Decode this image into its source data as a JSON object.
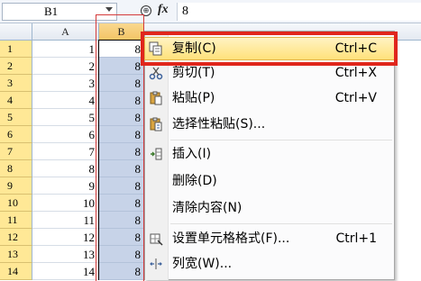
{
  "formula_bar": {
    "name_box": "B1",
    "zoom_icon_glyph": "⊕",
    "fx_label": "fx",
    "formula_value": "8"
  },
  "columns": {
    "a": "A",
    "b": "B"
  },
  "rows": [
    {
      "num": "1",
      "a": "1",
      "b": "8"
    },
    {
      "num": "2",
      "a": "2",
      "b": "8"
    },
    {
      "num": "3",
      "a": "3",
      "b": "8"
    },
    {
      "num": "4",
      "a": "4",
      "b": "8"
    },
    {
      "num": "5",
      "a": "5",
      "b": "8"
    },
    {
      "num": "6",
      "a": "6",
      "b": "8"
    },
    {
      "num": "7",
      "a": "7",
      "b": "8"
    },
    {
      "num": "8",
      "a": "8",
      "b": "8"
    },
    {
      "num": "9",
      "a": "9",
      "b": "8"
    },
    {
      "num": "10",
      "a": "10",
      "b": "8"
    },
    {
      "num": "11",
      "a": "11",
      "b": "8"
    },
    {
      "num": "12",
      "a": "12",
      "b": "8"
    },
    {
      "num": "13",
      "a": "13",
      "b": "8"
    },
    {
      "num": "14",
      "a": "14",
      "b": "8"
    }
  ],
  "context_menu": {
    "items": [
      {
        "label": "复制(C)",
        "shortcut": "Ctrl+C",
        "icon": "copy-icon"
      },
      {
        "label": "剪切(T)",
        "shortcut": "Ctrl+X",
        "icon": "scissors-icon"
      },
      {
        "label": "粘贴(P)",
        "shortcut": "Ctrl+V",
        "icon": "paste-icon"
      },
      {
        "label": "选择性粘贴(S)...",
        "shortcut": "",
        "icon": "paste-special-icon"
      },
      {
        "label": "插入(I)",
        "shortcut": "",
        "icon": "insert-icon"
      },
      {
        "label": "删除(D)",
        "shortcut": "",
        "icon": ""
      },
      {
        "label": "清除内容(N)",
        "shortcut": "",
        "icon": ""
      },
      {
        "label": "设置单元格格式(F)...",
        "shortcut": "Ctrl+1",
        "icon": "format-cells-icon"
      },
      {
        "label": "列宽(W)...",
        "shortcut": "",
        "icon": "column-width-icon"
      }
    ]
  },
  "colors": {
    "highlight_red": "#e0261c",
    "selection_blue": "#c7d3e8",
    "row_header_yellow": "#ffe896"
  }
}
